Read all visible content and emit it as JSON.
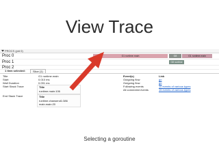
{
  "slide": {
    "title": "View Trace",
    "caption": "Selecting a goroutine"
  },
  "trace": {
    "procs_label": "PROCS (pid 0)",
    "procs": [
      {
        "name": "Proc 0"
      },
      {
        "name": "Proc 1"
      },
      {
        "name": "Proc 2"
      }
    ],
    "slices": [
      {
        "label": "G1 runtime.main",
        "color": "#d9a3ad"
      },
      {
        "label": "G8",
        "color": "#8a8f8a"
      },
      {
        "label": "G1 runtime.main",
        "color": "#c79aa7"
      },
      {
        "label": "G8 runtime",
        "color": "#7a8f86"
      }
    ]
  },
  "detail": {
    "items_selected": "1 item selected:",
    "slice_tab": "Slice (1)",
    "rows": [
      {
        "key": "Title",
        "value": "G1 runtime.main"
      },
      {
        "key": "Start",
        "value": "0.010 ms"
      },
      {
        "key": "Wall Duration",
        "value": "0.091 ms"
      },
      {
        "key": "Start Stack Trace",
        "value": ""
      },
      {
        "key": "End Stack Trace",
        "value": ""
      }
    ],
    "start_stack": {
      "header": "Title",
      "lines": [
        "runtime.main:106"
      ]
    },
    "end_stack": {
      "header": "Title",
      "lines": [
        "runtime.chansend1:386",
        "main.main:20"
      ]
    },
    "events_header": "Event(s)",
    "link_header": "Link",
    "events": [
      {
        "name": "Outgoing flow",
        "link": "go"
      },
      {
        "name": "Outgoing flow",
        "link": "go"
      },
      {
        "name": "Following events",
        "link": "10 events of various types"
      },
      {
        "name": "All connected events",
        "link": "15 events of various types"
      }
    ]
  },
  "colors": {
    "arrow": "#d93a2b",
    "link": "#1a5fc9"
  }
}
